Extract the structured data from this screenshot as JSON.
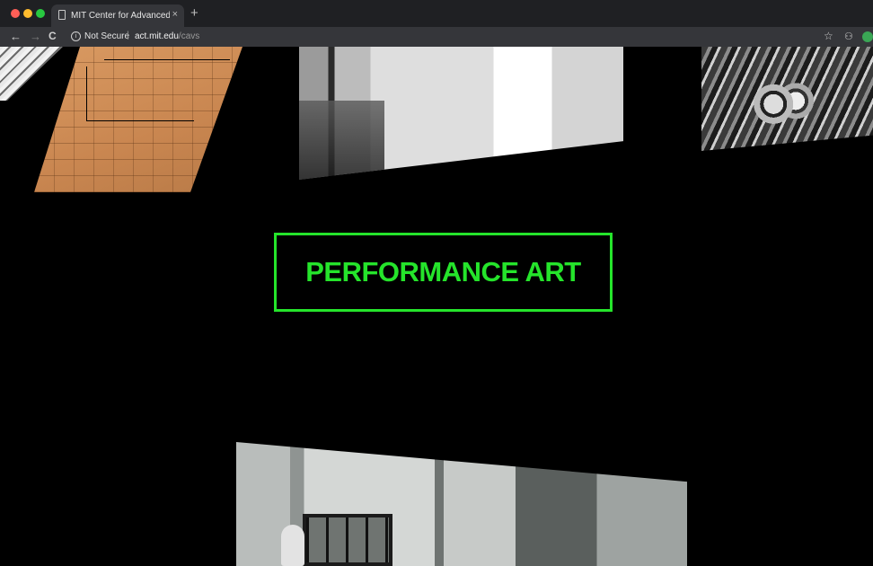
{
  "browser": {
    "tab_title": "MIT Center for Advanced Visua",
    "tab_close": "×",
    "new_tab": "+",
    "security_label": "Not Secure",
    "separator": "|",
    "url_host": "act.mit.edu",
    "url_path": "/cavs",
    "icons": {
      "back": "←",
      "forward": "→",
      "reload": "C",
      "info": "i",
      "bookmark": "☆",
      "extension": "⚇"
    }
  },
  "page": {
    "banner_text": "PERFORMANCE ART",
    "accent_color": "#25e42b",
    "background_color": "#000000"
  }
}
